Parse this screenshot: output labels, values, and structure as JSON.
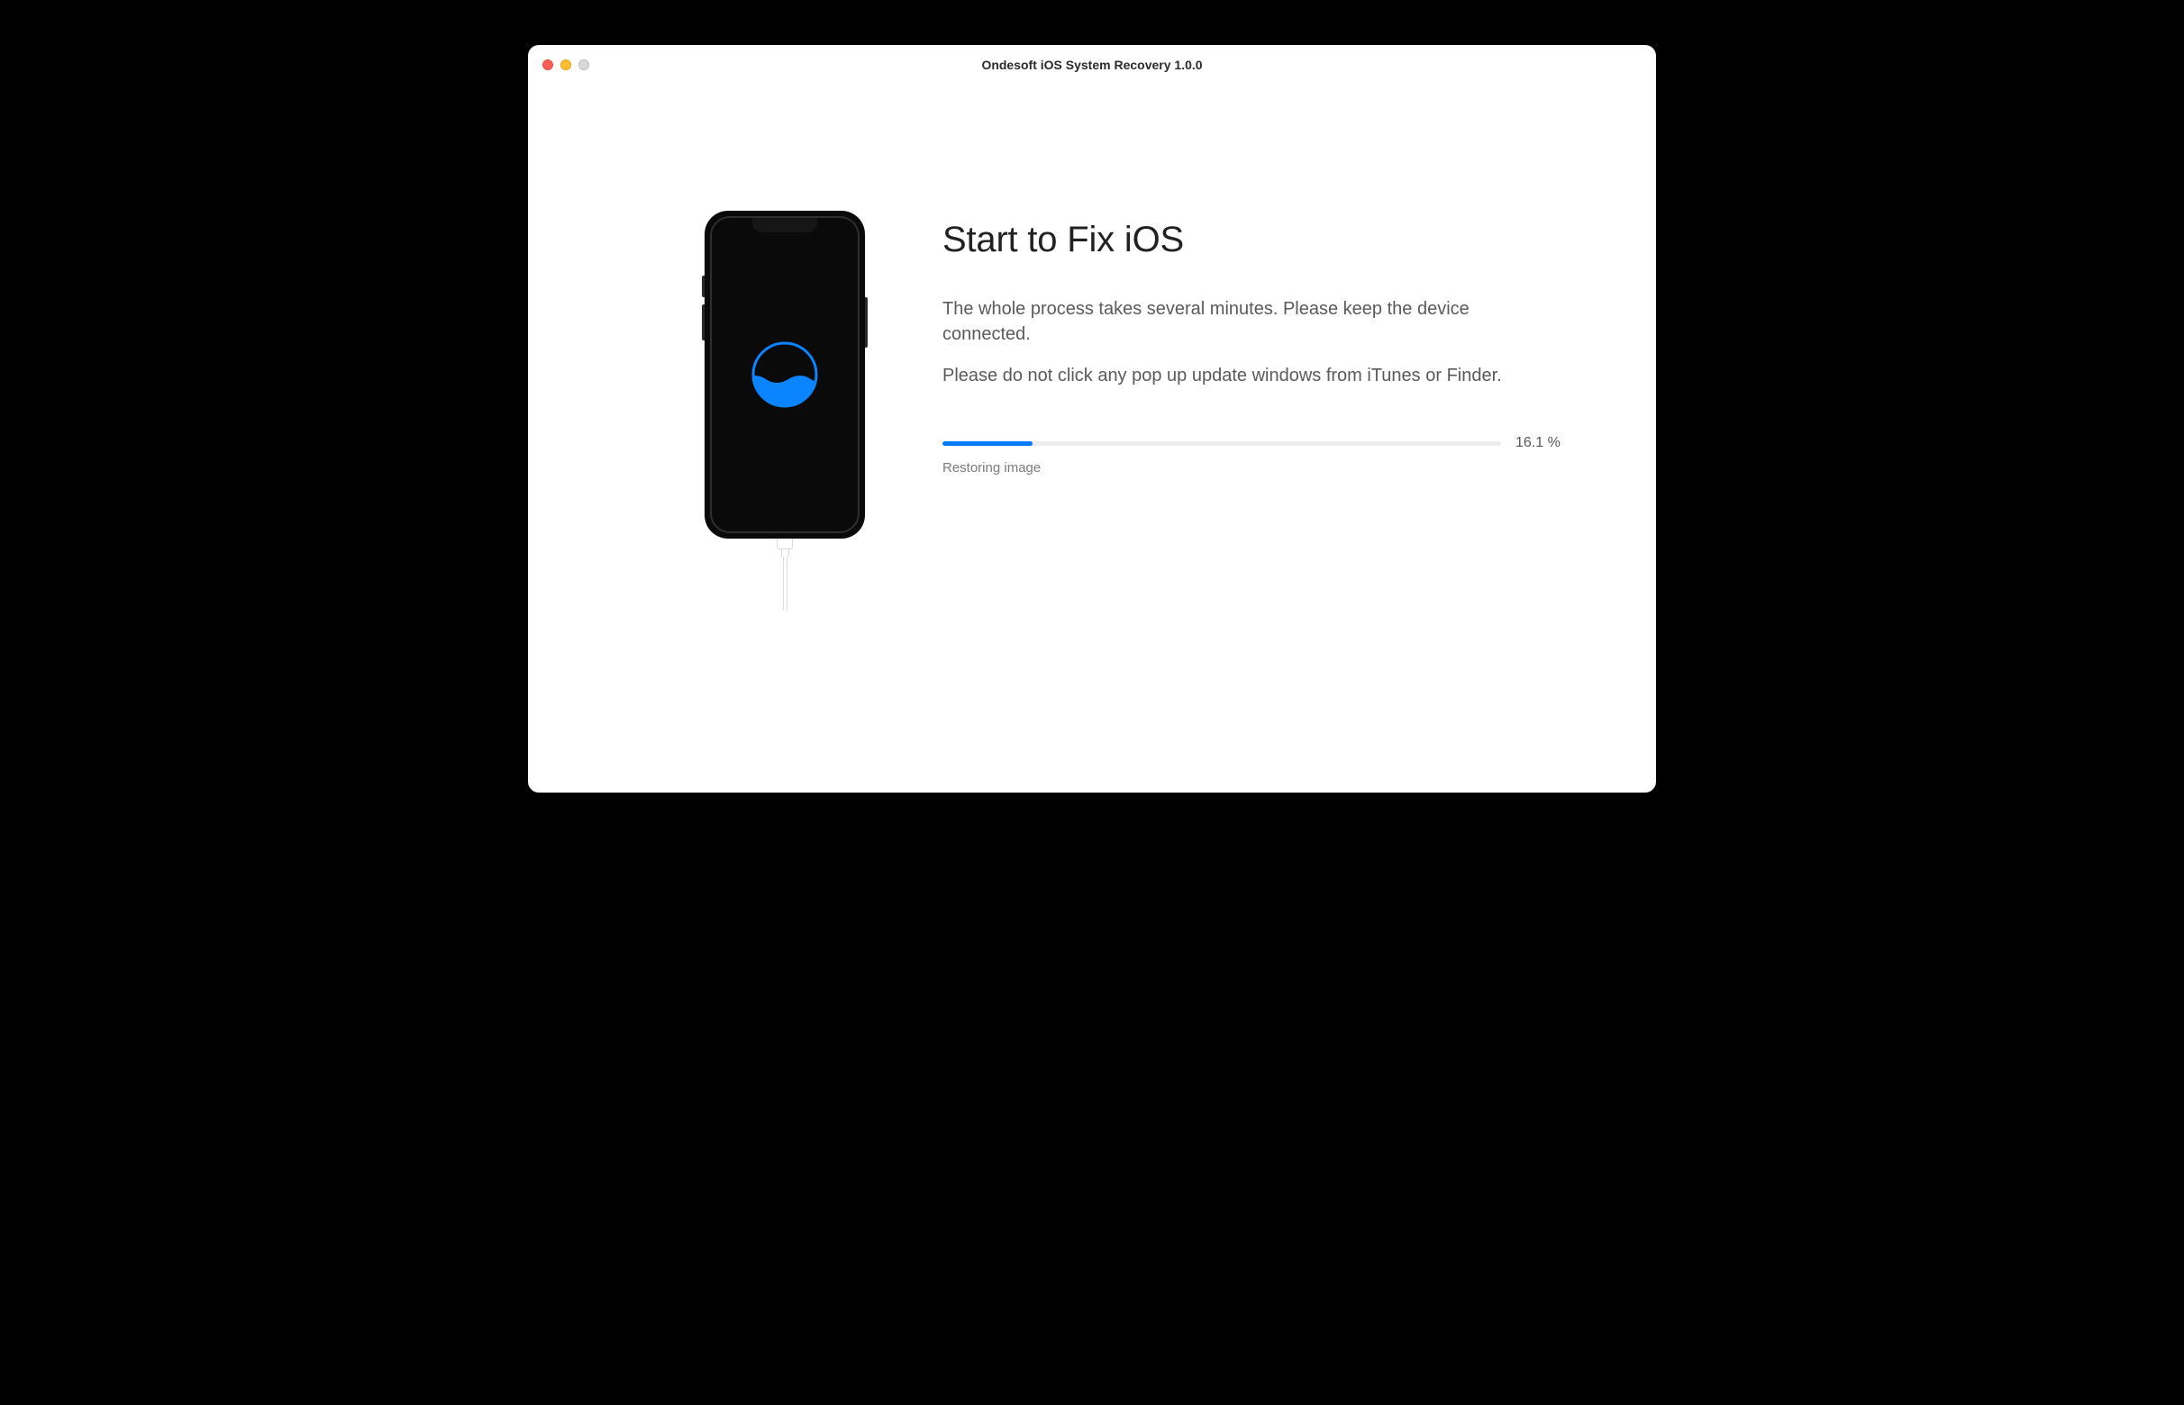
{
  "window": {
    "title": "Ondesoft iOS System Recovery 1.0.0"
  },
  "main": {
    "heading": "Start to Fix iOS",
    "description1": "The whole process takes several minutes. Please keep the device connected.",
    "description2": "Please do not click any pop up update windows from iTunes or Finder."
  },
  "progress": {
    "percent_value": 16.1,
    "percent_label": "16.1 %",
    "status": "Restoring image"
  },
  "colors": {
    "accent": "#007aff"
  }
}
